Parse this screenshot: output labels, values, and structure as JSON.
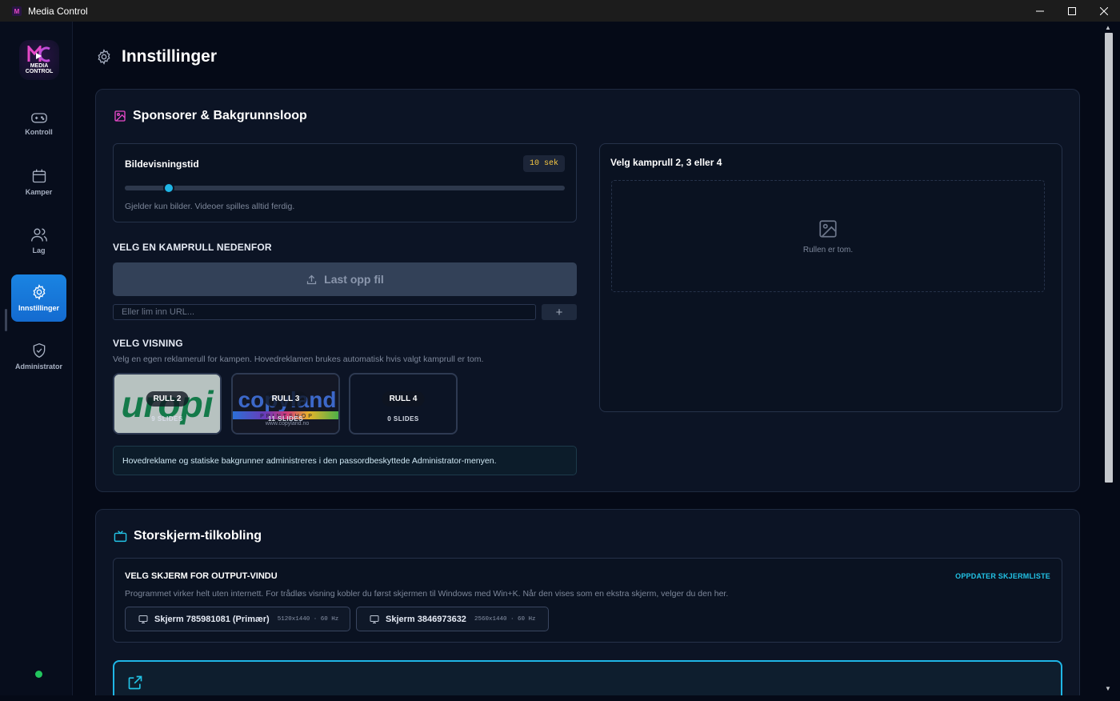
{
  "window": {
    "title": "Media Control"
  },
  "logo": {
    "text": "MEDIA CONTROL"
  },
  "sidebar": {
    "items": [
      {
        "label": "Kontroll",
        "icon": "gamepad-icon",
        "active": false
      },
      {
        "label": "Kamper",
        "icon": "calendar-icon",
        "active": false
      },
      {
        "label": "Lag",
        "icon": "users-icon",
        "active": false
      },
      {
        "label": "Innstillinger",
        "icon": "gear-icon",
        "active": true
      },
      {
        "label": "Administrator",
        "icon": "shield-check-icon",
        "active": false
      }
    ],
    "status_color": "#22c55e"
  },
  "page": {
    "title": "Innstillinger"
  },
  "sponsors": {
    "title": "Sponsorer & Bakgrunnsloop",
    "display_time": {
      "label": "Bildevisningstid",
      "value": "10 sek",
      "fraction": 0.1,
      "hint": "Gjelder kun bilder. Videoer spilles alltid ferdig."
    },
    "choose_roll_label": "VELG EN KAMPRULL NEDENFOR",
    "upload_label": "Last opp fil",
    "url_placeholder": "Eller lim inn URL...",
    "add_label": "+",
    "view_label": "VELG VISNING",
    "view_hint": "Velg en egen reklamerull for kampen. Hovedreklamen brukes automatisk hvis valgt kamprull er tom.",
    "rolls": [
      {
        "name": "RULL 2",
        "count": "9 SLIDES"
      },
      {
        "name": "RULL 3",
        "count": "11 SLIDES"
      },
      {
        "name": "RULL 4",
        "count": "0 SLIDES"
      }
    ],
    "thumb_texts": {
      "roll2": "uropi",
      "roll3": "copyland",
      "roll3_sub": "PRINTSHOP",
      "roll3_url": "www.copyland.no"
    },
    "info": "Hovedreklame og statiske bakgrunner administreres i den passordbeskyttede Administrator-menyen.",
    "right_panel": {
      "title": "Velg kamprull 2, 3 eller 4",
      "empty": "Rullen er tom."
    }
  },
  "bigscreen": {
    "title": "Storskjerm-tilkobling",
    "select_label": "VELG SKJERM FOR OUTPUT-VINDU",
    "refresh_label": "OPPDATER SKJERMLISTE",
    "hint": "Programmet virker helt uten internett. For trådløs visning kobler du først skjermen til Windows med Win+K. Når den vises som en ekstra skjerm, velger du den her.",
    "screens": [
      {
        "name": "Skjerm 785981081 (Primær)",
        "res": "5120x1440 · 60 Hz"
      },
      {
        "name": "Skjerm 3846973632",
        "res": "2560x1440 · 60 Hz"
      }
    ]
  },
  "colors": {
    "accent": "#1fb6e6",
    "active_nav": "#1a84e2",
    "badge": "#f7c843",
    "pink": "#e649c8"
  }
}
